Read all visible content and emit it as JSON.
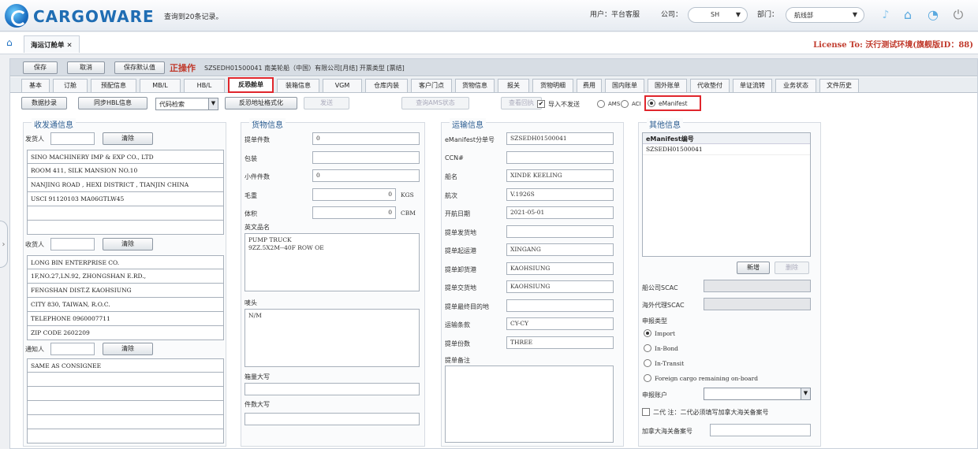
{
  "app": {
    "brand": "CARGOWARE",
    "record_info": "查询到20条记录。",
    "user_label": "用户：",
    "user_value": "平台客服",
    "company_label": "公司：",
    "company_value": "SH",
    "dept_label": "部门：",
    "dept_value": "航线部",
    "license": "License To: 沃行测试环境(旗舰版ID：88)"
  },
  "page_tab": {
    "label": "海运订舱单 ✕",
    "label_text": "海运订舱单"
  },
  "actions": {
    "save": "保存",
    "cancel": "取消",
    "save_default": "保存默认值",
    "current_op": "正操作",
    "info": "SZSEDH01500041  南美轮船（中国）有限公司[月结]  开票类型 [票结]"
  },
  "tabs": [
    "基本",
    "订舱",
    "预配信息",
    "MB/L",
    "HB/L",
    "反恐舱单",
    "装箱信息",
    "VGM",
    "仓库内装",
    "客户门点",
    "货物信息",
    "报关",
    "货物明细",
    "费用",
    "国内账单",
    "国外账单",
    "代收垫付",
    "单证流转",
    "业务状态",
    "文件历史"
  ],
  "active_tab": "反恐舱单",
  "tool": {
    "copy": "数据抄录",
    "sync_hbl": "同步HBL信息",
    "code_check": "代码检索",
    "format_addr": "反恐地址格式化",
    "send": "发送",
    "query_ams": "查询AMS状态",
    "view_receipt": "查看回执",
    "no_send_label": "导入不发送",
    "ams": "AMS",
    "aci": "ACI",
    "emanifest": "eManifest"
  },
  "party": {
    "title": "收发通信息",
    "shipper_label": "发货人",
    "clear": "清除",
    "shipper_lines": [
      "SINO MACHINERY IMP & EXP CO., LTD",
      "ROOM 411, SILK MANSION NO.10",
      "NANJING ROAD , HEXI DISTRICT , TIANJIN CHINA",
      "USCI 91120103 MA06GTLW45",
      "",
      ""
    ],
    "consignee_label": "收货人",
    "consignee_lines": [
      "LONG BIN ENTERPRISE CO.",
      "1F,NO.27,LN.92, ZHONGSHAN E.RD.,",
      "FENGSHAN DIST.Z KAOHSIUNG",
      "CITY 830, TAIWAN, R.O.C.",
      "TELEPHONE 0960007711",
      "ZIP CODE 2602209"
    ],
    "notify_label": "通知人",
    "notify_lines": [
      "SAME AS CONSIGNEE",
      "",
      "",
      "",
      "",
      ""
    ]
  },
  "cargo": {
    "title": "货物信息",
    "pieces_label": "提单件数",
    "pieces": "0",
    "pack_label": "包装",
    "pack": "",
    "small_label": "小件件数",
    "small": "0",
    "weight_label": "毛重",
    "weight": "0",
    "weight_unit": "KGS",
    "volume_label": "体积",
    "volume": "0",
    "volume_unit": "CBM",
    "desc_label": "英文品名",
    "desc": "PUMP TRUCK\n9ZZ.5X2M--40F ROW OE",
    "marks_label": "唛头",
    "marks": "N/M",
    "box_upper_label": "箱量大写",
    "box_upper": "",
    "pcs_upper_label": "件数大写",
    "pcs_upper": ""
  },
  "transport": {
    "title": "运输信息",
    "sub_no_label": "eManifest分单号",
    "sub_no": "SZSEDH01500041",
    "ccn_label": "CCN#",
    "ccn": "",
    "vessel_label": "船名",
    "vessel": "XINDE KEELING",
    "voyage_label": "航次",
    "voyage": "V.1926S",
    "sail_label": "开航日期",
    "sail": "2021-05-01",
    "receipt_label": "提单发货地",
    "receipt": "",
    "pol_label": "提单起运港",
    "pol": "XINGANG",
    "pod_label": "提单卸货港",
    "pod": "KAOHSIUNG",
    "delivery_label": "提单交货地",
    "delivery": "KAOHSIUNG",
    "final_label": "提单最终目的地",
    "final": "",
    "terms_label": "运输条款",
    "terms": "CY-CY",
    "bl_count_label": "提单份数",
    "bl_count": "THREE",
    "remark_label": "提单备注",
    "remark": ""
  },
  "other": {
    "title": "其他信息",
    "list_header": "eManifest编号",
    "list_items": [
      "SZSEDH01500041"
    ],
    "new": "新增",
    "delete": "删除",
    "carrier_scac_label": "船公司SCAC",
    "agent_scac_label": "海外代理SCAC",
    "decl_type_label": "申报类型",
    "types": [
      "Import",
      "In-Bond",
      "In-Transit",
      "Foreign cargo remaining on-board"
    ],
    "selected_type": "Import",
    "account_label": "申报账户",
    "second_gen_label": "二代 注：二代必须填写加拿大海关备案号",
    "canada_label": "加拿大海关备案号"
  }
}
